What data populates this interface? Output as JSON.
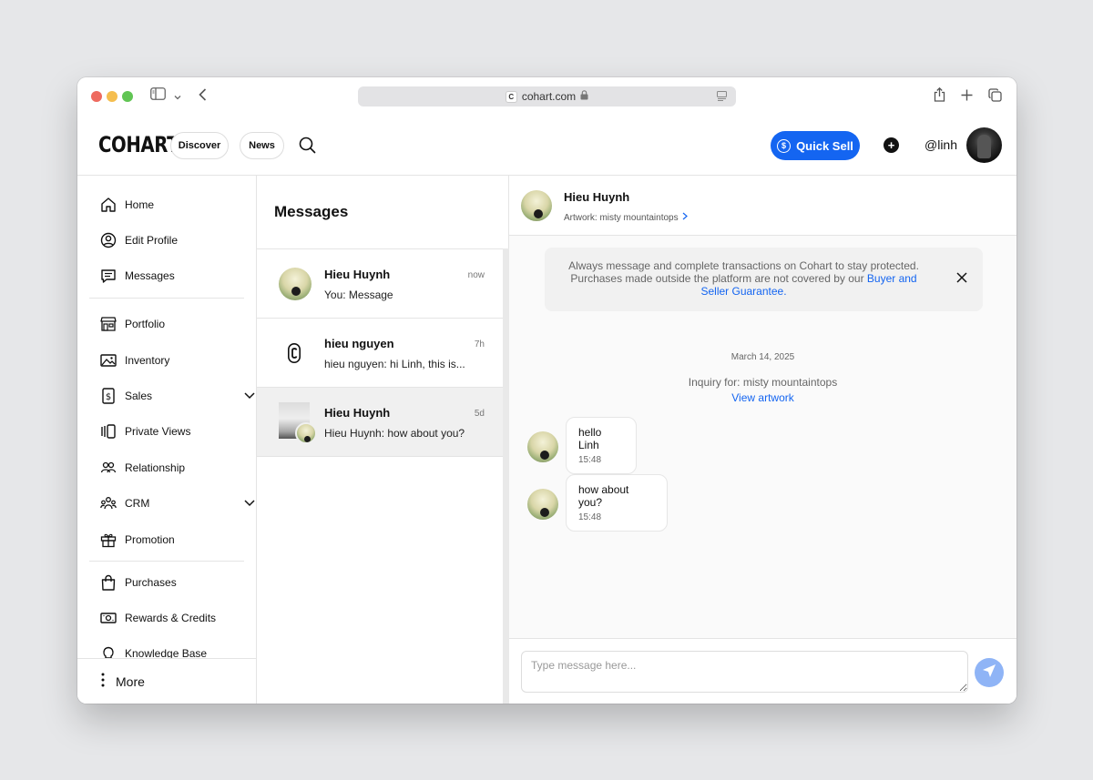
{
  "browser": {
    "url": "cohart.com",
    "favicon_letter": "C"
  },
  "header": {
    "logo": "COHART",
    "discover_label": "Discover",
    "news_label": "News",
    "quick_sell_label": "Quick Sell",
    "quick_sell_color": "#1465f1",
    "username": "@linh"
  },
  "sidebar": {
    "items": [
      {
        "label": "Home",
        "icon": "home-icon"
      },
      {
        "label": "Edit Profile",
        "icon": "user-circle-icon"
      },
      {
        "label": "Messages",
        "icon": "chat-icon"
      },
      {
        "label": "Portfolio",
        "icon": "storefront-icon"
      },
      {
        "label": "Inventory",
        "icon": "image-icon"
      },
      {
        "label": "Sales",
        "icon": "dollar-doc-icon"
      },
      {
        "label": "Private Views",
        "icon": "private-views-icon"
      },
      {
        "label": "Relationship",
        "icon": "people-icon"
      },
      {
        "label": "CRM",
        "icon": "group-icon"
      },
      {
        "label": "Promotion",
        "icon": "gift-icon"
      },
      {
        "label": "Purchases",
        "icon": "bag-icon"
      },
      {
        "label": "Rewards & Credits",
        "icon": "cash-icon"
      },
      {
        "label": "Knowledge Base",
        "icon": "lightbulb-icon"
      }
    ],
    "more_label": "More"
  },
  "messages": {
    "title": "Messages",
    "conversations": [
      {
        "name": "Hieu Huynh",
        "time": "now",
        "preview": "You: Message"
      },
      {
        "name": "hieu nguyen",
        "time": "7h",
        "preview": "hieu nguyen: hi Linh, this is..."
      },
      {
        "name": "Hieu Huynh",
        "time": "5d",
        "preview": "Hieu Huynh: how about you?"
      }
    ]
  },
  "chat": {
    "name": "Hieu Huynh",
    "artwork_label": "Artwork: misty mountaintops",
    "notice_text": "Always message and complete transactions on Cohart to stay protected. Purchases made outside the platform are not covered by our ",
    "notice_link": "Buyer and Seller Guarantee.",
    "date": "March 14, 2025",
    "inquiry": "Inquiry for: misty mountaintops",
    "view_artwork": "View artwork",
    "messages": [
      {
        "text": "hello Linh",
        "time": "15:48"
      },
      {
        "text": "how about you?",
        "time": "15:48"
      }
    ],
    "input_placeholder": "Type message here..."
  }
}
